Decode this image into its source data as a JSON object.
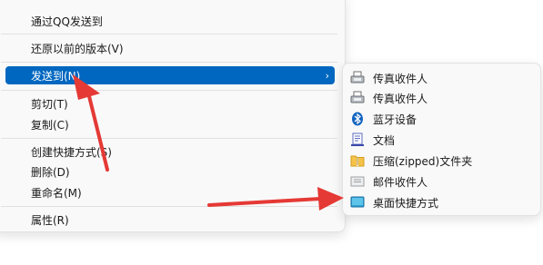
{
  "context_menu": {
    "items": [
      {
        "label": "通过QQ发送到"
      },
      {
        "label": "还原以前的版本(V)"
      },
      {
        "label": "发送到(N)"
      },
      {
        "label": "剪切(T)"
      },
      {
        "label": "复制(C)"
      },
      {
        "label": "创建快捷方式(S)"
      },
      {
        "label": "删除(D)"
      },
      {
        "label": "重命名(M)"
      },
      {
        "label": "属性(R)"
      }
    ],
    "submenu_chevron": "›"
  },
  "send_to_submenu": {
    "items": [
      {
        "label": "传真收件人",
        "icon": "fax-icon"
      },
      {
        "label": "传真收件人",
        "icon": "fax-icon"
      },
      {
        "label": "蓝牙设备",
        "icon": "bluetooth-icon"
      },
      {
        "label": "文档",
        "icon": "document-icon"
      },
      {
        "label": "压缩(zipped)文件夹",
        "icon": "zip-folder-icon"
      },
      {
        "label": "邮件收件人",
        "icon": "mail-icon"
      },
      {
        "label": "桌面快捷方式",
        "icon": "desktop-icon"
      }
    ]
  },
  "colors": {
    "highlight": "#0067c0",
    "annotation_arrow": "#e53935",
    "menu_background": "#f9f9f9"
  }
}
